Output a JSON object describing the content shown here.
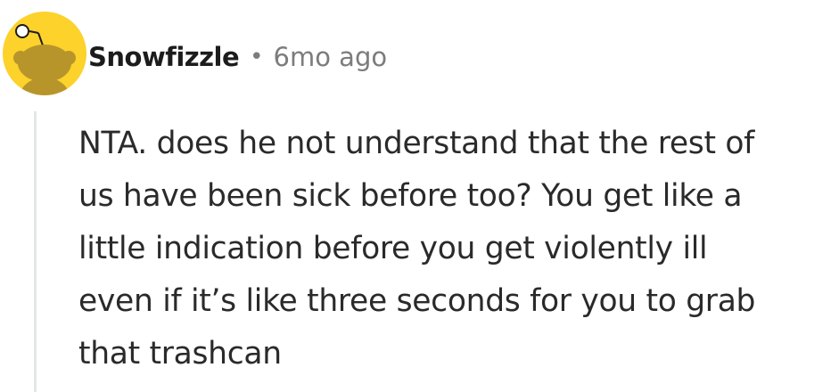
{
  "comment": {
    "username": "Snowfizzle",
    "separator": "•",
    "timestamp": "6mo ago",
    "avatar_icon": "snoo-avatar-icon",
    "colors": {
      "avatar_bg": "#fcd22b",
      "avatar_figure": "#b8952a",
      "username": "#1c1c1c",
      "meta": "#7c7c7c",
      "body": "#2a2a2a",
      "thread_line": "#e4e6e8"
    },
    "body_lines": [
      "NTA. does he not understand that the rest of",
      "us have been sick before too? You get like a",
      "little indication before you get violently ill",
      "even if it’s like three seconds for you to grab",
      "that trashcan"
    ]
  }
}
